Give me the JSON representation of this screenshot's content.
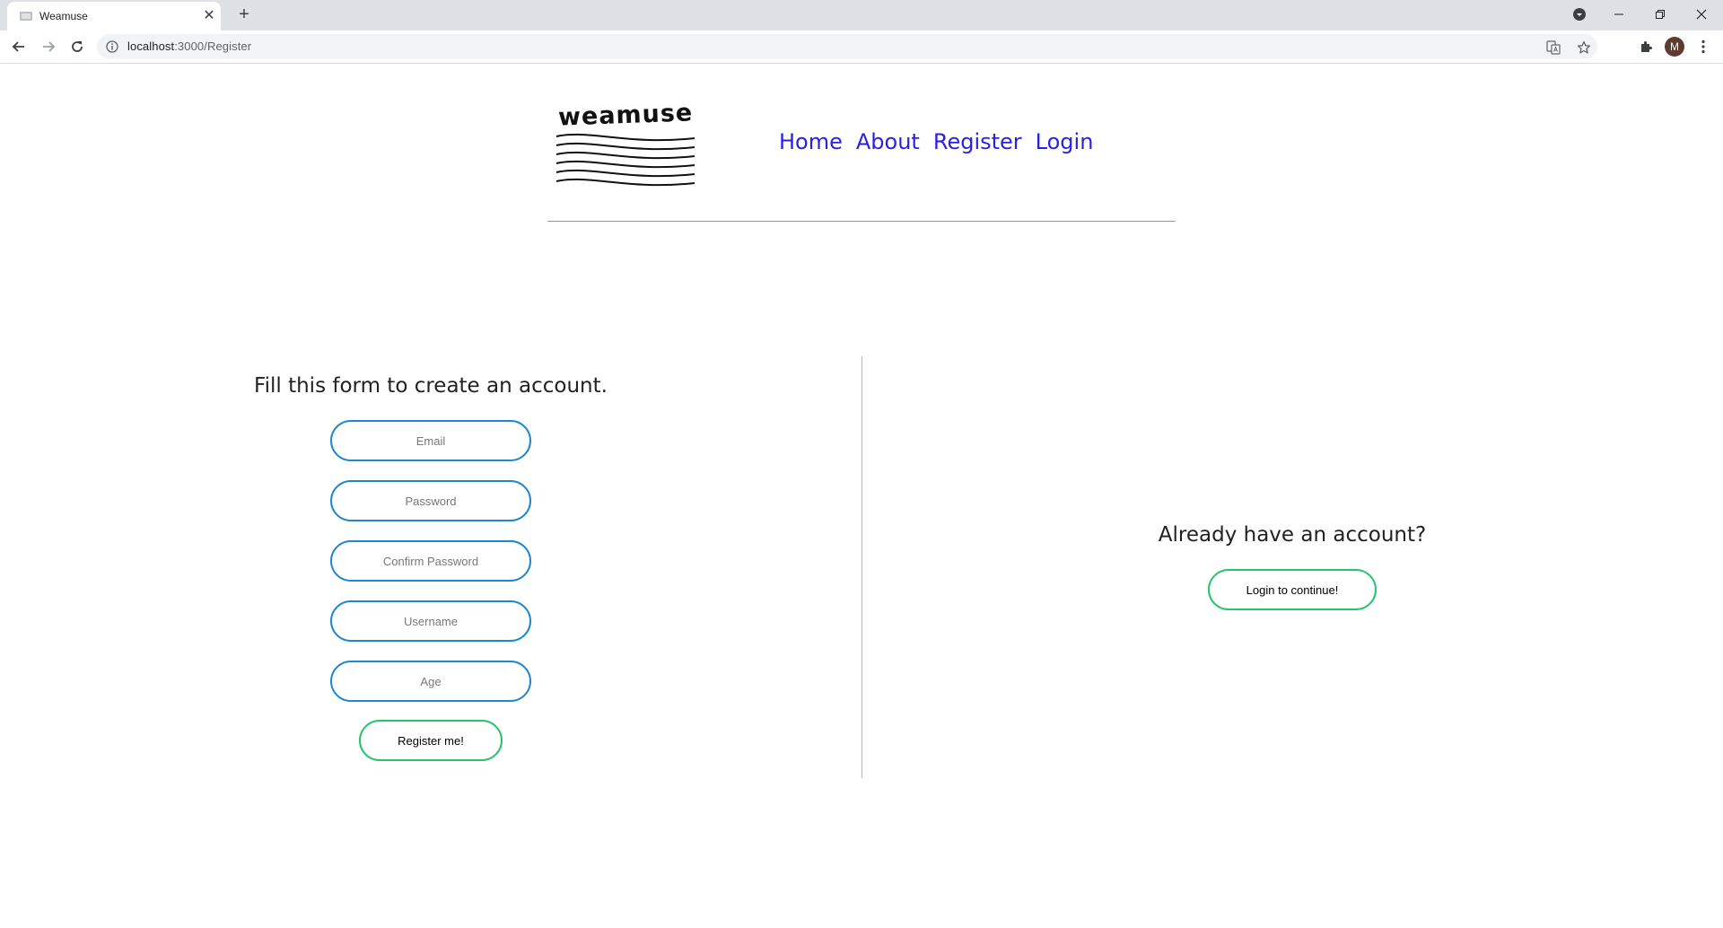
{
  "browser": {
    "tab_title": "Weamuse",
    "tab_close": "✕",
    "new_tab": "+",
    "url_host": "localhost",
    "url_path": ":3000/Register",
    "profile_initial": "M"
  },
  "site": {
    "logo_text": "weamuse",
    "nav": [
      "Home",
      "About",
      "Register",
      "Login"
    ]
  },
  "register_form": {
    "heading": "Fill this form to create an account.",
    "email_placeholder": "Email",
    "password_placeholder": "Password",
    "confirm_password_placeholder": "Confirm Password",
    "username_placeholder": "Username",
    "age_placeholder": "Age",
    "submit_label": "Register me!"
  },
  "login_prompt": {
    "heading": "Already have an account?",
    "button_label": "Login to continue!"
  },
  "colors": {
    "nav_link": "#2b1fe6",
    "input_border": "#1f86d1",
    "button_border": "#27c46a"
  }
}
